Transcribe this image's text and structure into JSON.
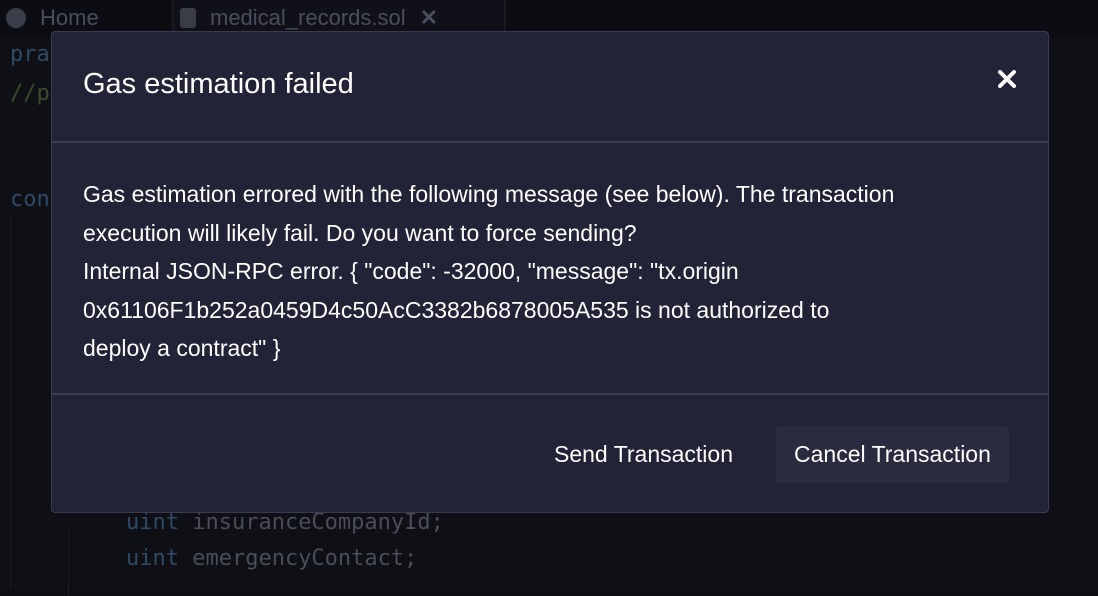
{
  "tabs": [
    {
      "label": "Home"
    },
    {
      "label": "medical_records.sol"
    }
  ],
  "code": {
    "line1": "pra",
    "line2": "//p",
    "line3": "con",
    "line4_kw": "uint",
    "line4_rest": " insuranceCompanyId;",
    "line5_kw": "uint",
    "line5_rest": " emergencyContact;"
  },
  "modal": {
    "title": "Gas estimation failed",
    "body_lines": [
      "Gas estimation errored with the following message (see below). The transaction",
      "execution will likely fail. Do you want to force sending?",
      "Internal JSON-RPC error. { \"code\": -32000, \"message\": \"tx.origin",
      "0x61106F1b252a0459D4c50AcC3382b6878005A535 is not authorized to",
      "deploy a contract\" }"
    ],
    "send_label": "Send Transaction",
    "cancel_label": "Cancel Transaction"
  }
}
